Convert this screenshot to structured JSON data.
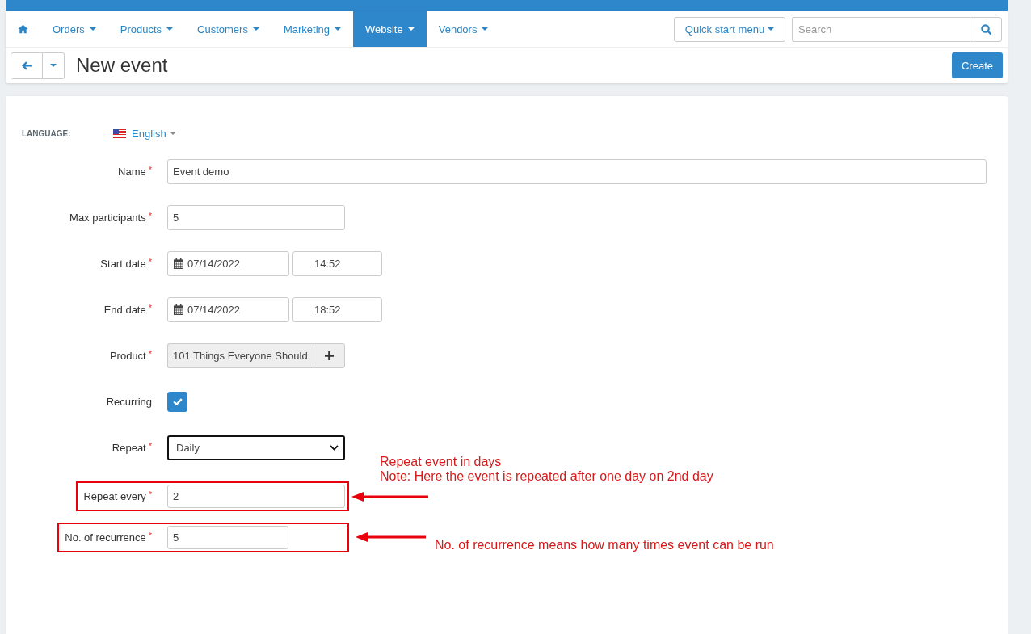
{
  "nav": {
    "items": [
      {
        "label": "Orders",
        "selected": false
      },
      {
        "label": "Products",
        "selected": false
      },
      {
        "label": "Customers",
        "selected": false
      },
      {
        "label": "Marketing",
        "selected": false
      },
      {
        "label": "Website",
        "selected": true
      },
      {
        "label": "Vendors",
        "selected": false
      }
    ],
    "quick_start_button": "Quick start menu",
    "search": {
      "placeholder": "Search"
    }
  },
  "page_header": {
    "title": "New event",
    "create_button": "Create"
  },
  "form": {
    "language": {
      "label": "LANGUAGE:",
      "value": "English"
    },
    "fields": [
      {
        "kind": "text",
        "label": "Name",
        "required_mark": "*",
        "value": "Event demo",
        "focused": false,
        "highlighted": false
      },
      {
        "kind": "text",
        "label": "Max participants",
        "required_mark": "*",
        "value": "5",
        "focused": false,
        "highlighted": false
      },
      {
        "kind": "datetime",
        "label": "Start date",
        "required_mark": "*",
        "date": "07/14/2022",
        "time": "14:52",
        "focused": false,
        "highlighted": false
      },
      {
        "kind": "datetime",
        "label": "End date",
        "required_mark": "*",
        "date": "07/14/2022",
        "time": "18:52",
        "focused": false,
        "highlighted": false
      },
      {
        "kind": "picker",
        "label": "Product",
        "required_mark": "*",
        "value": "101 Things Everyone Should",
        "focused": false,
        "highlighted": false
      },
      {
        "kind": "checkbox",
        "label": "Recurring",
        "checked": true,
        "focused": false,
        "highlighted": false
      },
      {
        "kind": "select",
        "label": "Repeat",
        "required_mark": "*",
        "value": "Daily",
        "focused": true,
        "highlighted": false
      },
      {
        "kind": "text",
        "label": "Repeat every",
        "required_mark": "*",
        "value": "2",
        "focused": false,
        "highlighted": true,
        "note": {
          "kind": "above",
          "lines": [
            "Repeat event in days",
            "Note: Here the event is repeated after one day on 2nd day"
          ]
        }
      },
      {
        "kind": "text",
        "label": "No. of recurrence",
        "required_mark": "*",
        "value": "5",
        "focused": false,
        "highlighted": true,
        "note": {
          "kind": "beside",
          "lines": [
            "No. of recurrence means how many times event can be run"
          ]
        }
      }
    ]
  }
}
